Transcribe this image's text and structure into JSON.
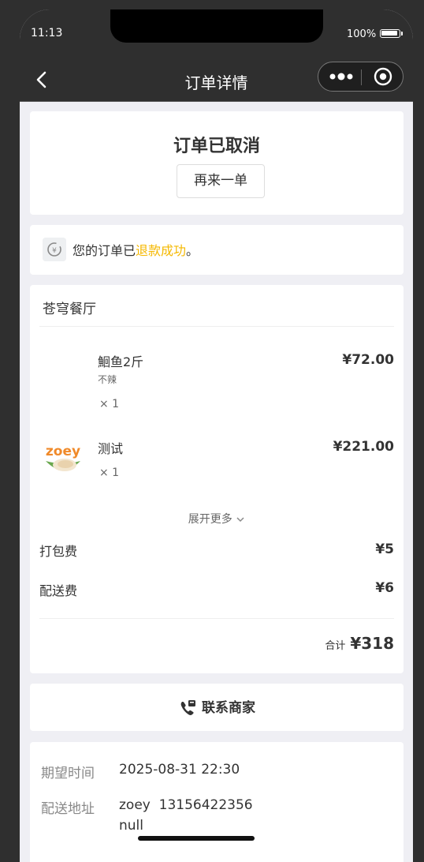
{
  "status_bar": {
    "time": "11:13",
    "battery": "100%"
  },
  "navbar": {
    "title": "订单详情"
  },
  "status_card": {
    "title": "订单已取消",
    "reorder_label": "再来一单"
  },
  "refund": {
    "prefix": "您的订单已",
    "highlight": "退款成功",
    "suffix": "。",
    "highlight_color": "#f5b800"
  },
  "shop": {
    "name": "苍穹餐厅",
    "items": [
      {
        "name": "鮰鱼2斤",
        "spec": "不辣",
        "qty": "× 1",
        "price": "¥72.00"
      },
      {
        "name": "测试",
        "qty": "× 1",
        "price": "¥221.00",
        "thumb_text": "zoey"
      }
    ],
    "expand_label": "展开更多",
    "fees": [
      {
        "label": "打包费",
        "value": "¥5"
      },
      {
        "label": "配送费",
        "value": "¥6"
      }
    ],
    "total_label": "合计",
    "total_value": "¥318"
  },
  "contact": {
    "label": "联系商家"
  },
  "info": {
    "expected_time_label": "期望时间",
    "expected_time_value": "2025-08-31 22:30",
    "address_label": "配送地址",
    "address_line1": "zoey  13156422356",
    "address_line2": "null"
  }
}
